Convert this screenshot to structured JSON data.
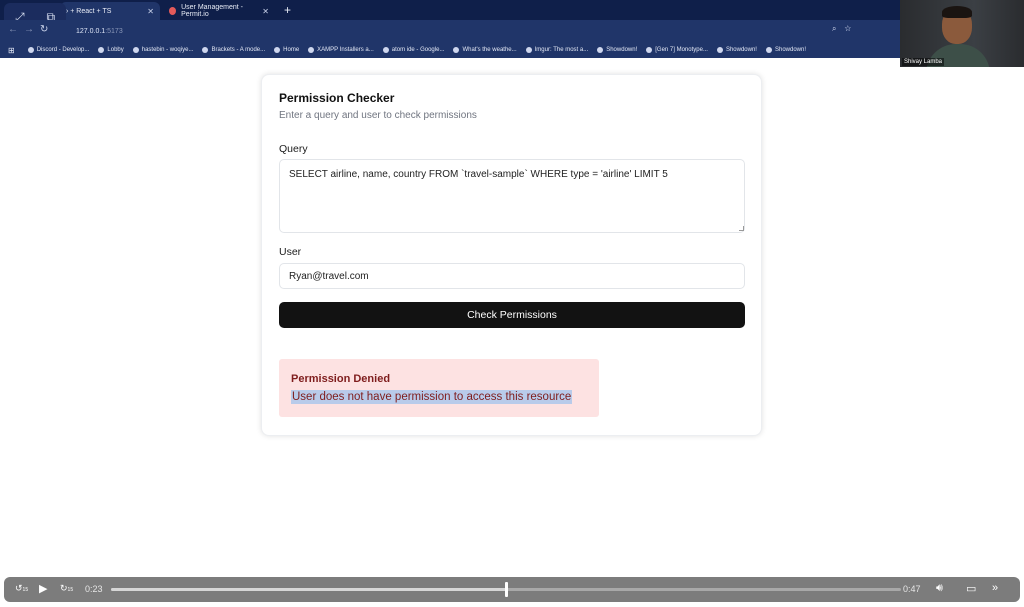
{
  "browser": {
    "tabs": [
      {
        "label": "› + React + TS",
        "active": true
      },
      {
        "label": "User Management - Permit.io",
        "active": false
      }
    ],
    "url_host": "127.0.0.1",
    "url_port": ":5173",
    "bookmarks": [
      "Discord - Develop...",
      "Lobby",
      "hastebin - woqiye...",
      "Brackets - A mode...",
      "Home",
      "XAMPP Installers a...",
      "atom ide - Google...",
      "What's the weathe...",
      "Imgur: The most a...",
      "Showdown!",
      "[Gen 7] Monotype...",
      "Showdown!",
      "Showdown!"
    ]
  },
  "webcam": {
    "name": "Shivay Lamba"
  },
  "checker": {
    "title": "Permission Checker",
    "subtitle": "Enter a query and user to check permissions",
    "query_label": "Query",
    "query_value": "SELECT airline, name, country FROM `travel-sample` WHERE type = 'airline' LIMIT 5",
    "user_label": "User",
    "user_value": "Ryan@travel.com",
    "button_label": "Check Permissions",
    "alert": {
      "title": "Permission Denied",
      "message": "User does not have permission to access this resource"
    }
  },
  "player": {
    "current_time": "0:23",
    "duration": "0:47",
    "progress": 0.5,
    "skip_back_label": "15",
    "skip_fwd_label": "15"
  },
  "colors": {
    "accent": "#121212",
    "alert_bg": "#fde2e2",
    "alert_text": "#7f1d1d",
    "chrome": "#203569"
  }
}
